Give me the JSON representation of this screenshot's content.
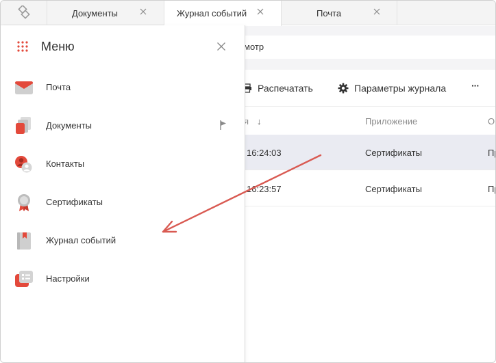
{
  "tabs": [
    {
      "label": "Документы",
      "active": false
    },
    {
      "label": "Журнал событий",
      "active": true
    },
    {
      "label": "Почта",
      "active": false
    }
  ],
  "address": {
    "text": "мотр"
  },
  "toolbar": {
    "print_label": "Распечатать",
    "settings_label": "Параметры журнала",
    "more_label": "···"
  },
  "table": {
    "headers": {
      "time": "я",
      "sort_icon": "↓",
      "app": "Приложение",
      "op": "О"
    },
    "rows": [
      {
        "time": "16:24:03",
        "app": "Сертификаты",
        "op": "Пр",
        "selected": true
      },
      {
        "time": "16:23:57",
        "app": "Сертификаты",
        "op": "Пр",
        "selected": false
      }
    ]
  },
  "menu": {
    "title": "Меню",
    "items": [
      {
        "label": "Почта",
        "icon": "mail-icon"
      },
      {
        "label": "Документы",
        "icon": "documents-icon",
        "pinned": true
      },
      {
        "label": "Контакты",
        "icon": "contacts-icon"
      },
      {
        "label": "Сертификаты",
        "icon": "certificate-icon"
      },
      {
        "label": "Журнал событий",
        "icon": "event-journal-icon"
      },
      {
        "label": "Настройки",
        "icon": "settings-icon"
      }
    ]
  },
  "colors": {
    "accent_red": "#e3493b",
    "annotation_arrow": "#d95a52",
    "selected_row": "#eaebf2"
  }
}
